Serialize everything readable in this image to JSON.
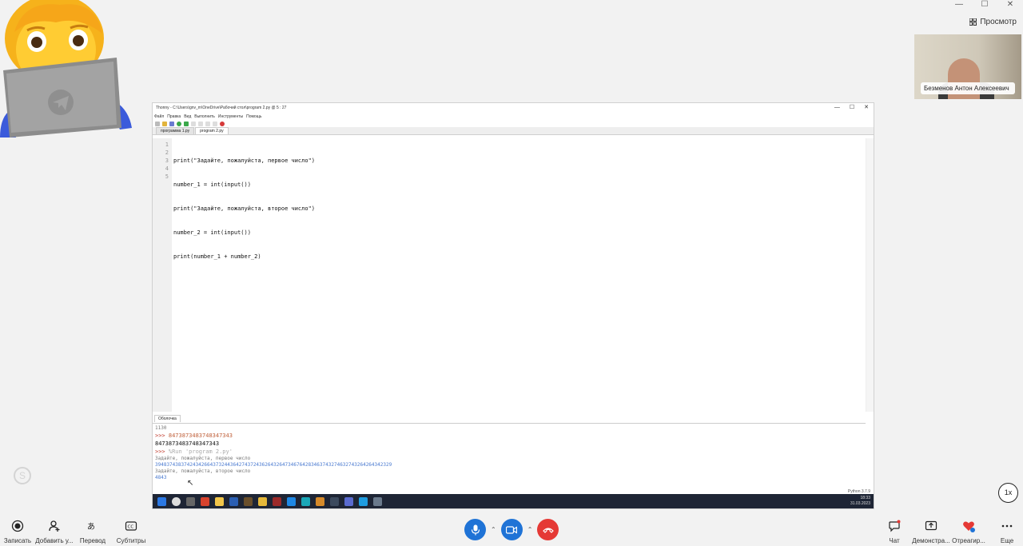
{
  "window": {
    "minimize": "—",
    "maximize": "☐",
    "close": "✕",
    "view_label": "Просмотр"
  },
  "participant": {
    "name": "Безменов Антон Алексеевич"
  },
  "ide": {
    "title": "Thonny  -  C:\\Users\\gnv_m\\OneDrive\\Рабочий стол\\program 2.py  @  5 : 27",
    "menu": [
      "Файл",
      "Правка",
      "Вид",
      "Выполнить",
      "Инструменты",
      "Помощь"
    ],
    "tabs": [
      "программа 1.py",
      "program 2.py"
    ],
    "line_numbers": [
      "1",
      "2",
      "3",
      "4",
      "5"
    ],
    "code_lines": [
      "print(\"Задайте, пожалуйста, первое число\")",
      "number_1 = int(input())",
      "print(\"Задайте, пожалуйста, второе число\")",
      "number_2 = int(input())",
      "print(number_1 + number_2)"
    ],
    "shell_tab": "Оболочка",
    "shell": {
      "line0": "1130",
      "prompt1": ">>>",
      "input1": "8473873483748347343",
      "output1": "8473873483748347343",
      "prompt2": ">>>",
      "run_cmd": "%Run 'program 2.py'",
      "ask1": "Задайте, пожалуйста, первое число",
      "val1": "3948374383742434266437324436427437243626432647346764283463743274632743264264342329",
      "ask2": "Задайте, пожалуйста, второе число",
      "val2": "4843"
    },
    "status": "Python 3.7.9",
    "clock_time": "18:33",
    "clock_date": "31.03.2023"
  },
  "bottom": {
    "record": "Записать",
    "add": "Добавить у...",
    "translate": "Перевод",
    "subtitles": "Субтитры",
    "chat": "Чат",
    "share": "Демонстра...",
    "react": "Отреагир...",
    "more": "Еще",
    "speed": "1x"
  },
  "colors": {
    "accent_blue": "#1f73d6",
    "hangup_red": "#e53935",
    "heart_red": "#e53935"
  }
}
